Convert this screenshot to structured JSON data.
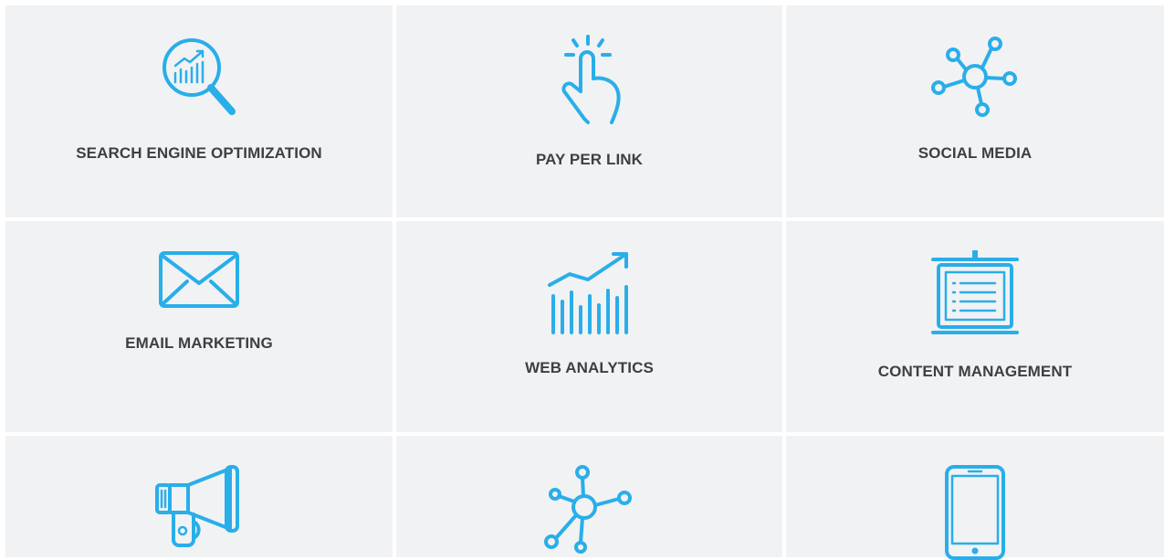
{
  "theme": {
    "accent": "#29aee9",
    "tile_bg": "#f1f2f4",
    "text": "#3d3f44"
  },
  "services": [
    {
      "label": "SEARCH ENGINE OPTIMIZATION",
      "icon": "magnifier-chart-icon"
    },
    {
      "label": "PAY PER LINK",
      "icon": "tap-finger-icon"
    },
    {
      "label": "SOCIAL MEDIA",
      "icon": "network-nodes-icon"
    },
    {
      "label": "EMAIL MARKETING",
      "icon": "envelope-icon"
    },
    {
      "label": "WEB ANALYTICS",
      "icon": "growth-chart-icon"
    },
    {
      "label": "CONTENT MANAGEMENT",
      "icon": "presentation-board-icon"
    },
    {
      "label": "",
      "icon": "megaphone-icon"
    },
    {
      "label": "",
      "icon": "network-hub-icon"
    },
    {
      "label": "",
      "icon": "smartphone-icon"
    }
  ]
}
